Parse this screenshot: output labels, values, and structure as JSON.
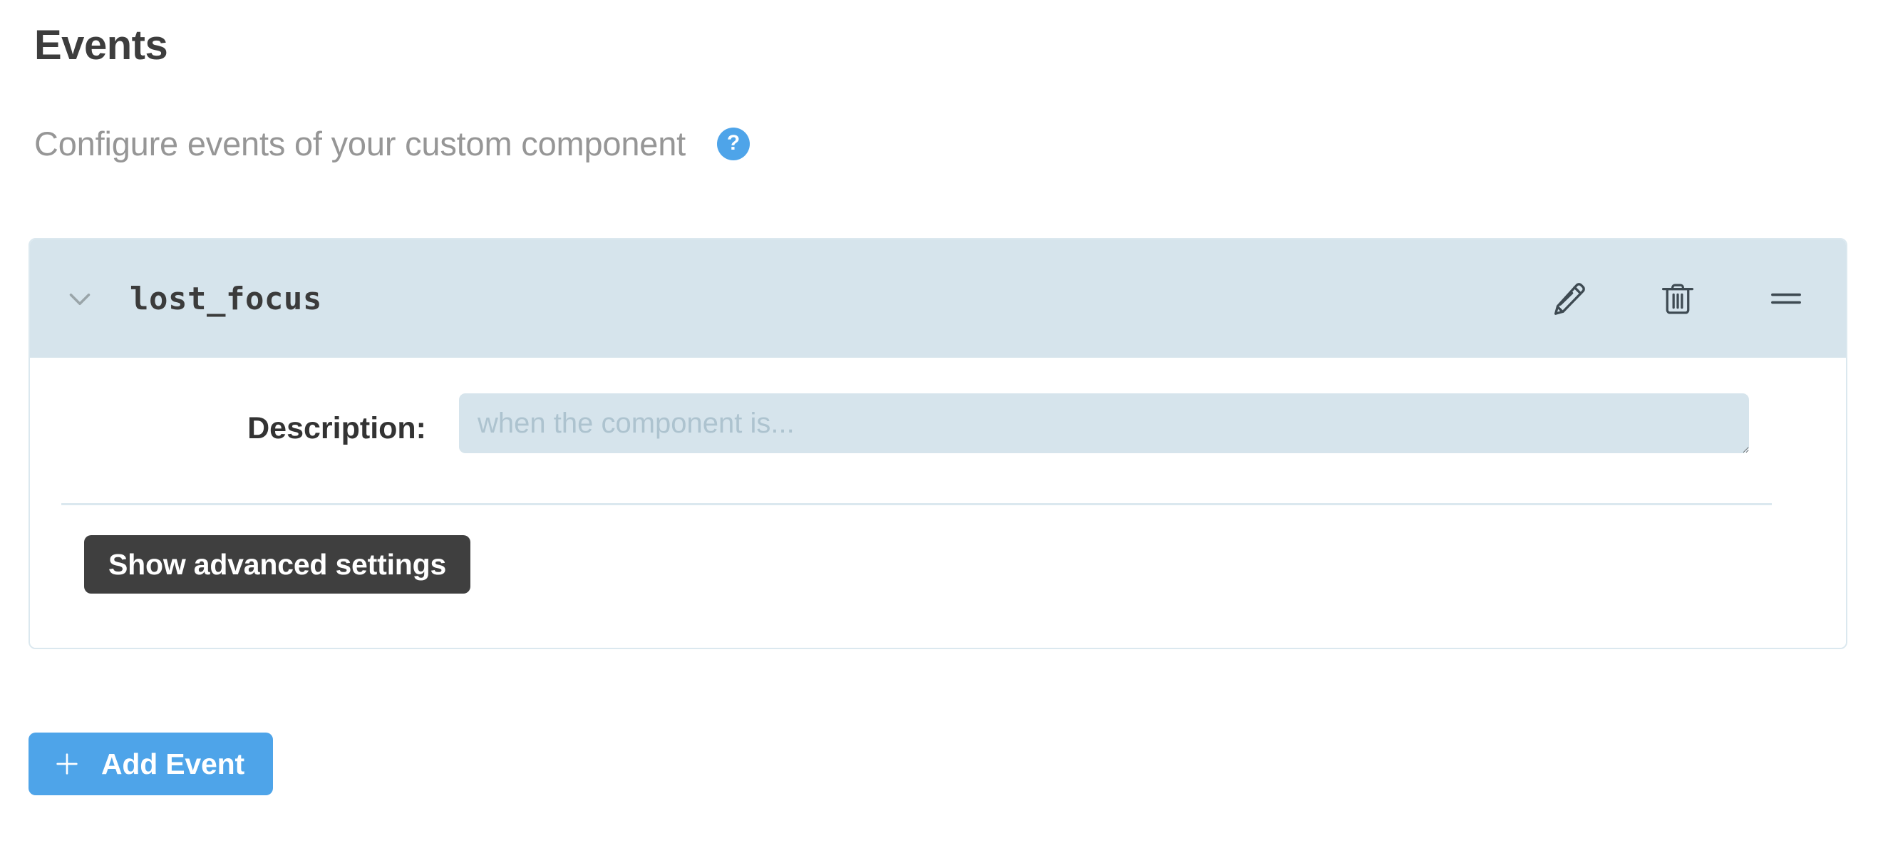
{
  "header": {
    "title": "Events",
    "subtitle": "Configure events of your custom component",
    "help_label": "?"
  },
  "events": [
    {
      "name": "lost_focus",
      "expanded": true,
      "description_label": "Description:",
      "description_value": "",
      "description_placeholder": "when the component is...",
      "advanced_button_label": "Show advanced settings",
      "actions": {
        "edit": "pencil-icon",
        "delete": "trash-icon",
        "reorder": "drag-handle-icon"
      }
    }
  ],
  "footer": {
    "add_event_label": "Add Event",
    "add_icon": "plus-icon"
  },
  "colors": {
    "accent_blue": "#4ea4e9",
    "header_band": "#d6e4ec",
    "card_border": "#dbe8ef",
    "dark_button": "#3f3f3f",
    "title_text": "#3d3d3d",
    "subtitle_text": "#969696",
    "placeholder_text": "#adc3cf"
  }
}
